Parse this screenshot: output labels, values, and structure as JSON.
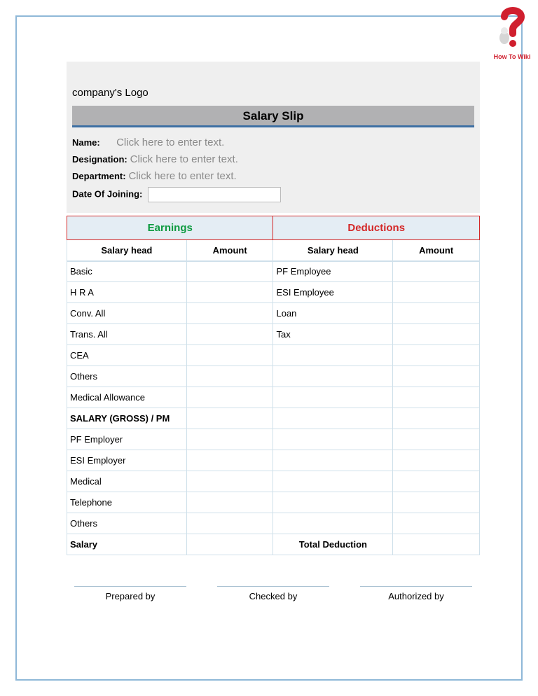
{
  "logo": {
    "caption": "How To Wiki"
  },
  "company_logo": "company's Logo",
  "title": "Salary Slip",
  "info": {
    "name_label": "Name:",
    "name_placeholder": "Click here to enter text.",
    "designation_label": "Designation:",
    "designation_placeholder": "Click here to enter text.",
    "department_label": "Department:",
    "department_placeholder": "Click here to enter text.",
    "doj_label": "Date Of Joining:",
    "doj_value": ""
  },
  "headers": {
    "earnings": "Earnings",
    "deductions": "Deductions",
    "earn_col1": "Salary head",
    "earn_col2": "Amount",
    "ded_col1": "Salary head",
    "ded_col2": "Amount"
  },
  "rows": {
    "r0": {
      "e_head": "Basic",
      "e_amt": "",
      "d_head": "PF Employee",
      "d_amt": ""
    },
    "r1": {
      "e_head": "H R A",
      "e_amt": "",
      "d_head": "ESI Employee",
      "d_amt": ""
    },
    "r2": {
      "e_head": "Conv. All",
      "e_amt": "",
      "d_head": "Loan",
      "d_amt": ""
    },
    "r3": {
      "e_head": "Trans. All",
      "e_amt": "",
      "d_head": "Tax",
      "d_amt": ""
    },
    "r4": {
      "e_head": "CEA",
      "e_amt": "",
      "d_head": "",
      "d_amt": ""
    },
    "r5": {
      "e_head": "Others",
      "e_amt": "",
      "d_head": "",
      "d_amt": ""
    },
    "r6": {
      "e_head": "Medical Allowance",
      "e_amt": "",
      "d_head": "",
      "d_amt": ""
    },
    "r7": {
      "e_head": "SALARY (GROSS) / PM",
      "e_amt": "",
      "d_head": "",
      "d_amt": ""
    },
    "r8": {
      "e_head": "PF Employer",
      "e_amt": "",
      "d_head": "",
      "d_amt": ""
    },
    "r9": {
      "e_head": "ESI Employer",
      "e_amt": "",
      "d_head": "",
      "d_amt": ""
    },
    "r10": {
      "e_head": "Medical",
      "e_amt": "",
      "d_head": "",
      "d_amt": ""
    },
    "r11": {
      "e_head": "Telephone",
      "e_amt": "",
      "d_head": "",
      "d_amt": ""
    },
    "r12": {
      "e_head": "Others",
      "e_amt": "",
      "d_head": "",
      "d_amt": ""
    },
    "r13": {
      "e_head": "Salary",
      "e_amt": "",
      "d_head": "Total Deduction",
      "d_amt": ""
    }
  },
  "signatures": {
    "prepared": "Prepared by",
    "checked": "Checked by",
    "authorized": "Authorized by"
  }
}
